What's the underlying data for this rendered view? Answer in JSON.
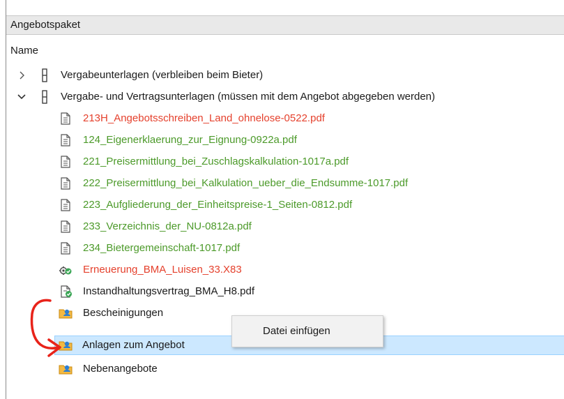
{
  "panel": {
    "title": "Angebotspaket"
  },
  "tree": {
    "column_header": "Name",
    "folders": [
      {
        "label": "Vergabeunterlagen (verbleiben beim Bieter)",
        "expanded": false
      },
      {
        "label": "Vergabe- und Vertragsunterlagen (müssen mit dem Angebot abgegeben werden)",
        "expanded": true
      }
    ],
    "files": [
      {
        "label": "213H_Angebotsschreiben_Land_ohnelose-0522.pdf",
        "color": "#e5412d",
        "icon": "document-icon"
      },
      {
        "label": "124_Eigenerklaerung_zur_Eignung-0922a.pdf",
        "color": "#4c9a2a",
        "icon": "document-icon"
      },
      {
        "label": "221_Preisermittlung_bei_Zuschlagskalkulation-1017a.pdf",
        "color": "#4c9a2a",
        "icon": "document-icon"
      },
      {
        "label": "222_Preisermittlung_bei_Kalkulation_ueber_die_Endsumme-1017.pdf",
        "color": "#4c9a2a",
        "icon": "document-icon"
      },
      {
        "label": "223_Aufgliederung_der_Einheitspreise-1_Seiten-0812.pdf",
        "color": "#4c9a2a",
        "icon": "document-icon"
      },
      {
        "label": "233_Verzeichnis_der_NU-0812a.pdf",
        "color": "#4c9a2a",
        "icon": "document-icon"
      },
      {
        "label": "234_Bietergemeinschaft-1017.pdf",
        "color": "#4c9a2a",
        "icon": "document-icon"
      },
      {
        "label": "Erneuerung_BMA_Luisen_33.X83",
        "color": "#e5412d",
        "icon": "gear-check-icon"
      },
      {
        "label": "Instandhaltungsvertrag_BMA_H8.pdf",
        "color": "#1a1a1a",
        "icon": "document-check-icon"
      }
    ],
    "subfolders": [
      {
        "label": "Bescheinigungen",
        "selected": false
      },
      {
        "label": "Anlagen zum Angebot",
        "selected": true
      },
      {
        "label": "Nebenangebote",
        "selected": false
      }
    ]
  },
  "context_menu": {
    "items": [
      {
        "label": "Datei einfügen"
      }
    ]
  },
  "colors": {
    "selection": "#cce8ff",
    "annotation": "#e8231a"
  }
}
